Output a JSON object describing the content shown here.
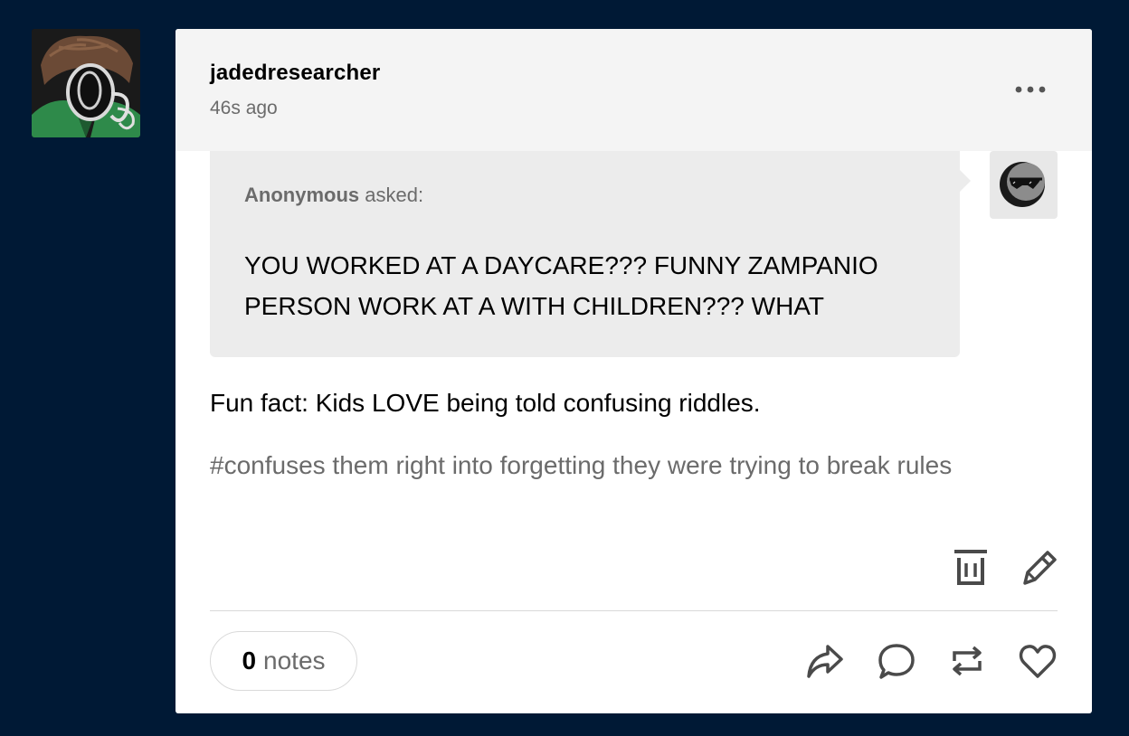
{
  "post": {
    "blog_name": "jadedresearcher",
    "timestamp": "46s ago",
    "ask": {
      "asker": "Anonymous",
      "asked_label": "asked:",
      "question": "YOU WORKED AT A DAYCARE??? FUNNY ZAMPANIO PERSON WORK AT A WITH CHILDREN??? WHAT"
    },
    "answer": "Fun fact: Kids LOVE being told confusing riddles.",
    "tags": "#confuses them right into forgetting they were trying to break rules",
    "notes": {
      "count": "0",
      "label": "notes"
    }
  },
  "icons": {
    "more": "more-options-icon",
    "delete": "trash-icon",
    "edit": "pencil-icon",
    "share": "share-icon",
    "reply": "reply-icon",
    "reblog": "reblog-icon",
    "like": "heart-icon"
  },
  "colors": {
    "background": "#001935",
    "card": "#ffffff",
    "header": "#f4f4f4",
    "ask_bubble": "#ececec",
    "muted_text": "#6b6b6b",
    "icon": "#4a4a4a"
  }
}
